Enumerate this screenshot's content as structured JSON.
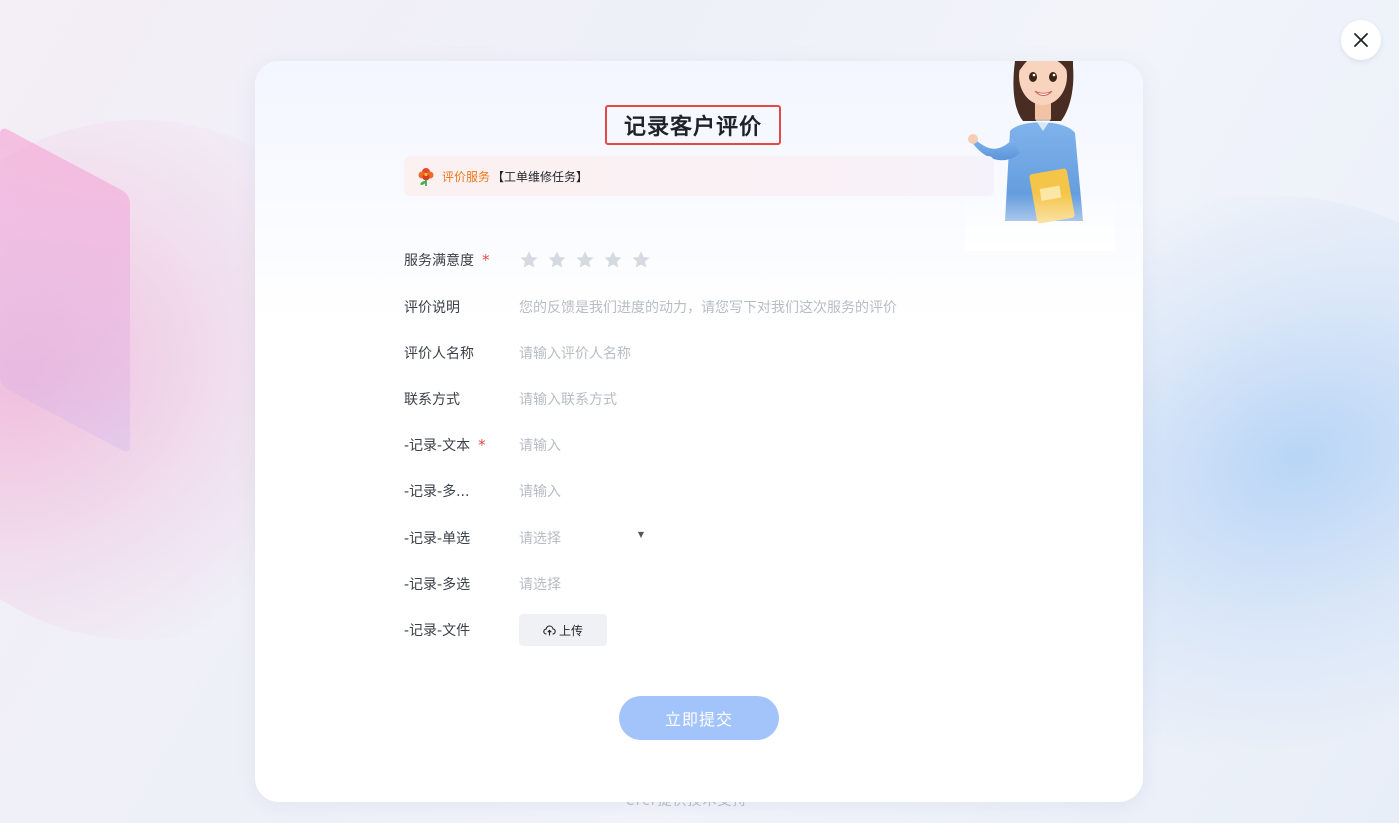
{
  "page": {
    "title": "记录客户评价",
    "footer_text": "ercr提供技术支持"
  },
  "service": {
    "label": "评价服务",
    "task": "【工单维修任务】"
  },
  "form": {
    "satisfaction": {
      "label": "服务满意度",
      "required": "*",
      "rating": 0,
      "max": 5
    },
    "comment": {
      "label": "评价说明",
      "placeholder": "您的反馈是我们进度的动力，请您写下对我们这次服务的评价"
    },
    "reviewer": {
      "label": "评价人名称",
      "placeholder": "请输入评价人名称"
    },
    "contact": {
      "label": "联系方式",
      "placeholder": "请输入联系方式"
    },
    "text_field": {
      "label": "-记录-文本",
      "required": "*",
      "placeholder": "请输入"
    },
    "multiline_field": {
      "label": "-记录-多...",
      "placeholder": "请输入"
    },
    "single_select": {
      "label": "-记录-单选",
      "placeholder": "请选择"
    },
    "multi_select": {
      "label": "-记录-多选",
      "placeholder": "请选择"
    },
    "file_field": {
      "label": "-记录-文件",
      "button": "上传"
    }
  },
  "submit_label": "立即提交",
  "icons": {
    "close": "close-icon",
    "flower": "flower-icon",
    "star": "star-icon",
    "upload": "cloud-upload-icon",
    "caret": "caret-down-icon"
  },
  "colors": {
    "required": "#e4494a",
    "service_accent": "#f0771a",
    "submit_bg": "#a3c4fb",
    "star_empty": "#d5d9e0"
  }
}
